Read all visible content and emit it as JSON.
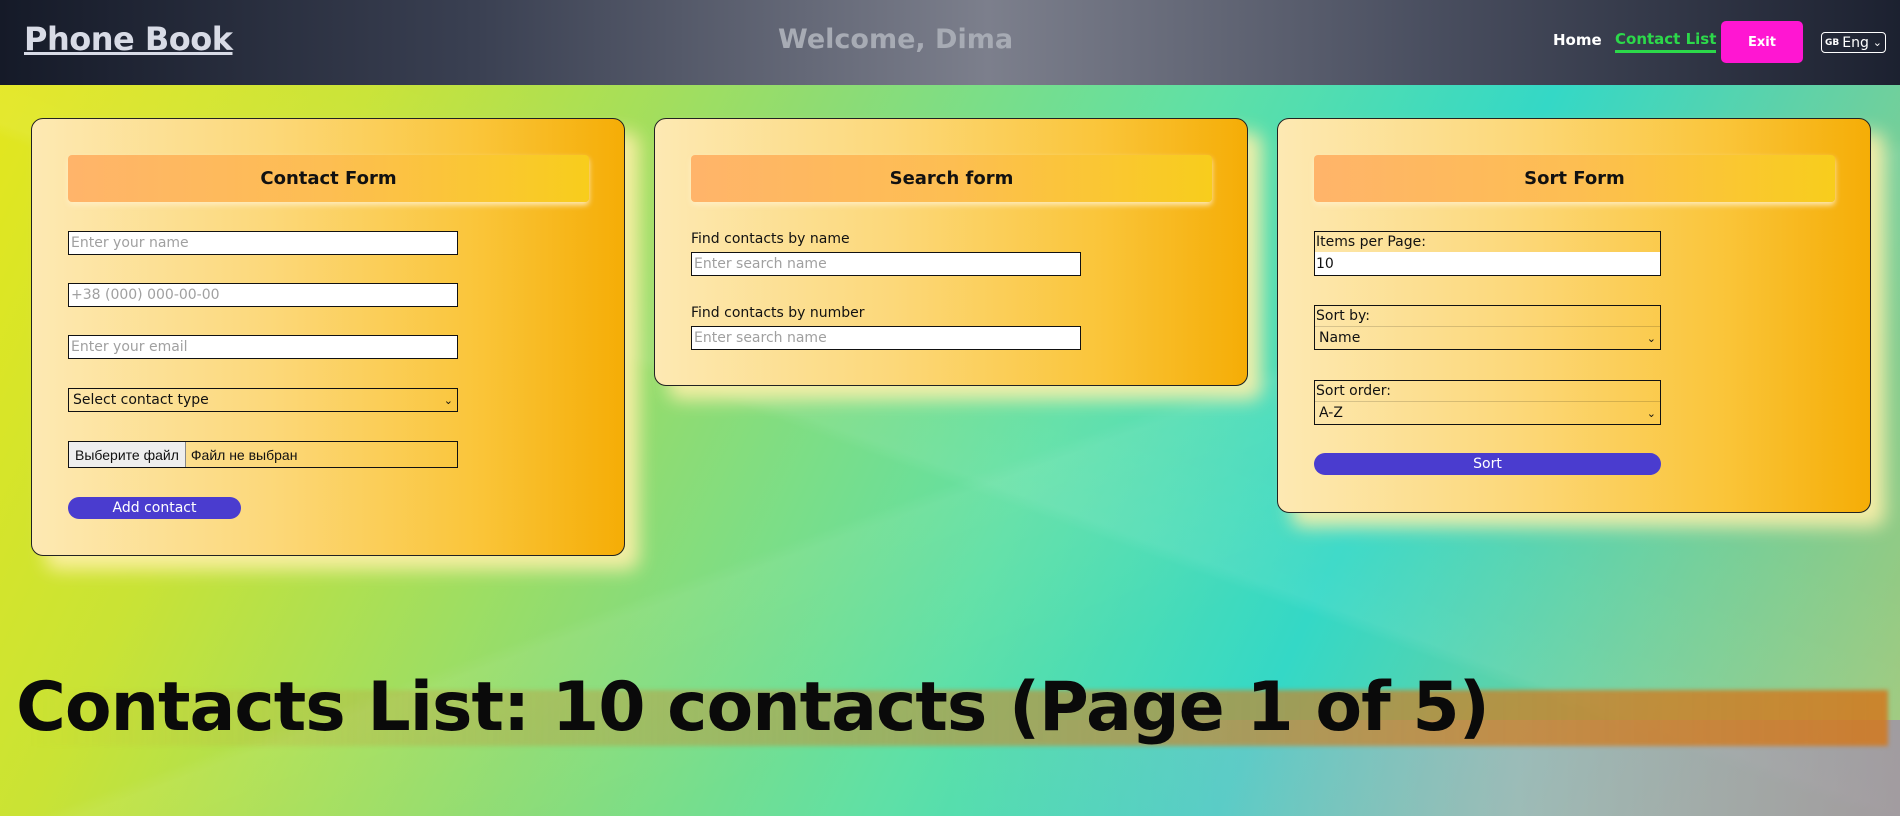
{
  "header": {
    "brand": "Phone Book",
    "welcome": "Welcome, Dima",
    "nav": {
      "home": "Home",
      "contact_list": "Contact List"
    },
    "exit_label": "Exit",
    "language": {
      "flag": "GB",
      "label": "Eng"
    },
    "active_nav_color": "#2cd94a",
    "exit_color": "#ff16d2"
  },
  "contact_form": {
    "title": "Contact Form",
    "name_placeholder": "Enter your name",
    "phone_placeholder": "+38 (000) 000-00-00",
    "email_placeholder": "Enter your email",
    "type_select": "Select contact type",
    "file_button": "Выберите файл",
    "file_status": "Файл не выбран",
    "submit_label": "Add contact"
  },
  "search_form": {
    "title": "Search form",
    "by_name_label": "Find contacts by name",
    "by_name_placeholder": "Enter search name",
    "by_number_label": "Find contacts by number",
    "by_number_placeholder": "Enter search name"
  },
  "sort_form": {
    "title": "Sort Form",
    "items_per_page_label": "Items per Page:",
    "items_per_page_value": "10",
    "sort_by_label": "Sort by:",
    "sort_by_value": "Name",
    "sort_order_label": "Sort order:",
    "sort_order_value": "A-Z",
    "submit_label": "Sort"
  },
  "contacts_list": {
    "title": "Contacts List: 10 contacts (Page 1 of 5)"
  },
  "colors": {
    "button_primary": "#4a3ccf",
    "card_gradient_start": "#fde9b3",
    "card_gradient_end": "#f5ad06"
  }
}
